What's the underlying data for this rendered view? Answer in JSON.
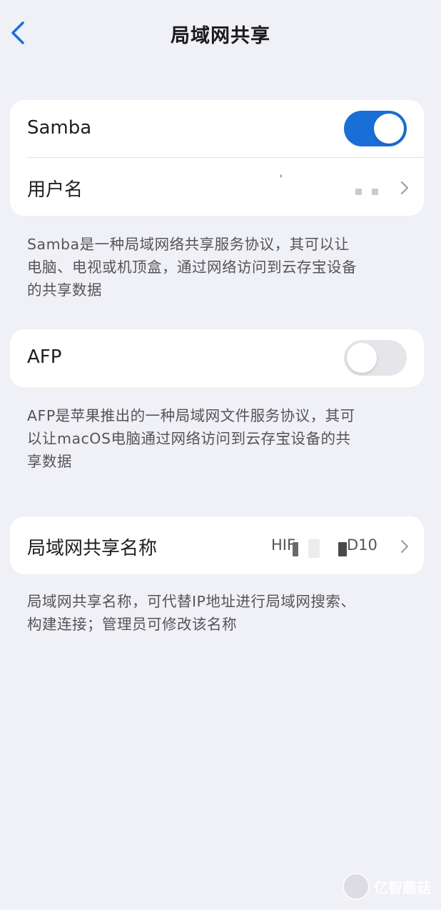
{
  "header": {
    "title": "局域网共享",
    "back_icon": "chevron-left-icon"
  },
  "samba_card": {
    "samba_label": "Samba",
    "samba_enabled": true,
    "username_label": "用户名",
    "username_value": "'"
  },
  "samba_desc": [
    "Samba是一种局域网络共享服务协议，其可以让",
    "电脑、电视或机顶盒，通过网络访问到云存宝设备",
    "的共享数据"
  ],
  "afp_card": {
    "afp_label": "AFP",
    "afp_enabled": false
  },
  "afp_desc": [
    "AFP是苹果推出的一种局域网文件服务协议，其可",
    "以让macOS电脑通过网络访问到云存宝设备的共",
    "享数据"
  ],
  "share_name_card": {
    "label": "局域网共享名称",
    "value_prefix": "HIF",
    "value_suffix": "D10"
  },
  "share_name_desc": [
    "局域网共享名称，可代替IP地址进行局域网搜索、",
    "构建连接；管理员可修改该名称"
  ],
  "watermark": {
    "text": "亿智蘑菇"
  },
  "colors": {
    "accent": "#1a6fd6",
    "background": "#f0f0f7",
    "card": "#ffffff",
    "toggle_off": "#e6e6ea"
  }
}
